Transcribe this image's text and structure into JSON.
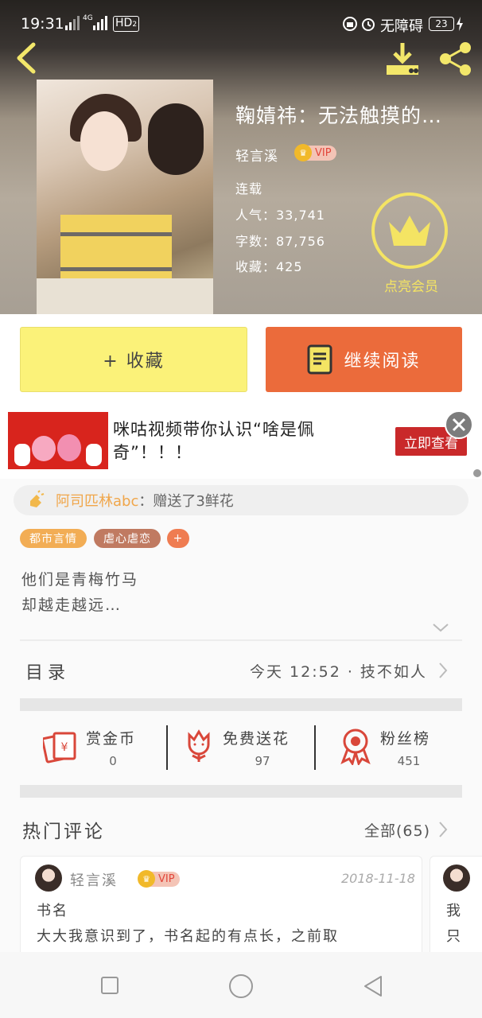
{
  "status_bar": {
    "time": "19:31",
    "network": "4G",
    "hd": "HD",
    "sim": "2",
    "accessibility": "无障碍",
    "battery": "23"
  },
  "book": {
    "title": "鞠婧祎：无法触摸的…",
    "author": "轻言溪",
    "vip": "VIP",
    "status": "连载",
    "popularity": "人气：33,741",
    "word_count": "字数：87,756",
    "favorites": "收藏：425",
    "member_label": "点亮会员"
  },
  "actions": {
    "favorite": "+ 收藏",
    "continue": "继续阅读"
  },
  "ad": {
    "text": "咪咕视频带你认识“啥是佩奇”！！！",
    "button": "立即查看"
  },
  "gift": {
    "user": "阿司匹林abc",
    "message": "：赠送了3鲜花"
  },
  "tags": [
    "都市言情",
    "虐心虐恋",
    "+"
  ],
  "description": [
    "他们是青梅竹马",
    "却越走越远…"
  ],
  "catalog": {
    "label": "目录",
    "latest": "今天 12:52 · 技不如人"
  },
  "stats": [
    {
      "label": "赏金币",
      "value": "0",
      "icon": "reward-coin-icon"
    },
    {
      "label": "免费送花",
      "value": "97",
      "icon": "flower-icon"
    },
    {
      "label": "粉丝榜",
      "value": "451",
      "icon": "medal-icon"
    }
  ],
  "comments": {
    "heading": "热门评论",
    "all": "全部(65)",
    "items": [
      {
        "user": "轻言溪",
        "vip": "VIP",
        "date": "2018-11-18",
        "title": "书名",
        "body": "大大我意识到了，书名起的有点长，之前取"
      },
      {
        "user": "",
        "title": "我",
        "body": "只"
      }
    ]
  },
  "colors": {
    "yellow": "#fbf279",
    "orange": "#eb6b3b",
    "member": "#f4e463"
  }
}
